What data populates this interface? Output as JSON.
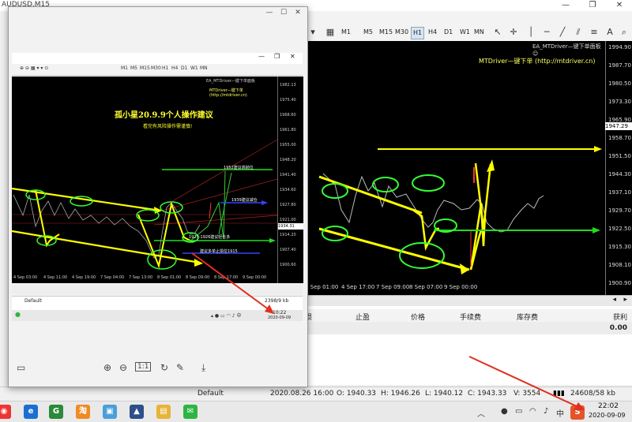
{
  "terminal": {
    "title": "AUDUSD,M15",
    "timeframes": [
      "M1",
      "M5",
      "M15",
      "M30",
      "H1",
      "H4",
      "D1",
      "W1",
      "MN"
    ],
    "active_timeframe": "H1",
    "chart": {
      "ea_label": "EA_MTDriver—键下单面板 ☺",
      "mtdriver_label": "MTDriver—键下单 (http://mtdriver.cn)",
      "current_price": "1947.29",
      "y_ticks": [
        "1994.90",
        "1987.70",
        "1980.50",
        "1973.30",
        "1965.90",
        "1958.70",
        "1951.50",
        "1944.30",
        "1937.10",
        "1929.70",
        "1922.50",
        "1915.30",
        "1908.10",
        "1900.90"
      ],
      "x_ticks": [
        "3 Sep 01:00",
        "4 Sep 17:00",
        "7 Sep 09:00",
        "8 Sep 07:00",
        "9 Sep 00:00"
      ]
    },
    "trade_panel": {
      "headers": [
        "损",
        "止盈",
        "价格",
        "手续费",
        "库存费",
        "获利"
      ],
      "total": "0.00"
    },
    "status_bar": {
      "profile": "Default",
      "datetime": "2020.08.26 16:00",
      "open": "O: 1940.33",
      "high": "H: 1946.26",
      "low": "L: 1940.12",
      "close": "C: 1943.33",
      "volume": "V: 3554",
      "traffic": "24608/58 kb"
    }
  },
  "viewer": {
    "inner_chart": {
      "title": "孤小星20.9.9个人操作建议",
      "subtitle": "看完有风险操作需谨慎!",
      "ea_label": "EA_MTDriver—键下单面板",
      "mtdriver_label": "MTDriver—键下单 (http://mtdriver.cn)",
      "annotation_1952": "1952建议高抛位",
      "annotation_1939": "1939建议减仓",
      "annotation_support": "1923-1926建议轻仓多",
      "annotation_stop": "建议多单止损位1915",
      "y_ticks": [
        "1982.13",
        "1975.40",
        "1968.60",
        "1961.80",
        "1955.00",
        "1948.20",
        "1941.40",
        "1934.60",
        "1927.80",
        "1921.00",
        "1914.20",
        "1907.40",
        "1900.60"
      ],
      "x_ticks": [
        "4 Sep 03:00",
        "4 Sep 11:00",
        "4 Sep 19:00",
        "7 Sep 04:00",
        "7 Sep 13:00",
        "8 Sep 01:00",
        "8 Sep 09:00",
        "8 Sep 17:00",
        "9 Sep 00:00"
      ],
      "current_price": "1934.31"
    },
    "inner_status": {
      "profile": "Default",
      "traffic": "2398/9 kb"
    },
    "inner_clock": {
      "time": "10:22",
      "date": "2020-09-09"
    }
  },
  "taskbar": {
    "time": "22:02",
    "date": "2020-09-09"
  },
  "colors": {
    "chart_bg": "#000000",
    "trend_yellow": "#ffff00",
    "circle_green": "#33ff33",
    "arrow_red": "#e03020",
    "level_green": "#22dd22",
    "level_blue": "#3344ff"
  }
}
